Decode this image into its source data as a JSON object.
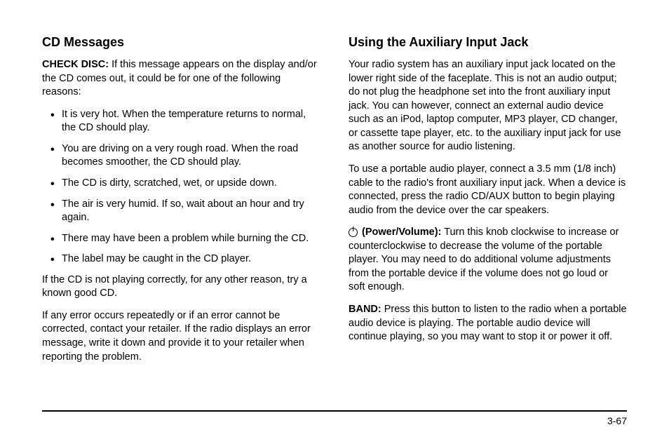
{
  "left": {
    "heading": "CD Messages",
    "check_disc_label": "CHECK DISC:",
    "check_disc_text": " If this message appears on the display and/or the CD comes out, it could be for one of the following reasons:",
    "bullets": [
      "It is very hot. When the temperature returns to normal, the CD should play.",
      "You are driving on a very rough road. When the road becomes smoother, the CD should play.",
      "The CD is dirty, scratched, wet, or upside down.",
      "The air is very humid. If so, wait about an hour and try again.",
      "There may have been a problem while burning the CD.",
      "The label may be caught in the CD player."
    ],
    "para2": "If the CD is not playing correctly, for any other reason, try a known good CD.",
    "para3": "If any error occurs repeatedly or if an error cannot be corrected, contact your retailer. If the radio displays an error message, write it down and provide it to your retailer when reporting the problem."
  },
  "right": {
    "heading": "Using the Auxiliary Input Jack",
    "para1": "Your radio system has an auxiliary input jack located on the lower right side of the faceplate. This is not an audio output; do not plug the headphone set into the front auxiliary input jack. You can however, connect an external audio device such as an iPod, laptop computer, MP3 player, CD changer, or cassette tape player, etc. to the auxiliary input jack for use as another source for audio listening.",
    "para2": "To use a portable audio player, connect a 3.5 mm (1/8 inch) cable to the radio's front auxiliary input jack. When a device is connected, press the radio CD/AUX button to begin playing audio from the device over the car speakers.",
    "power_label": " (Power/Volume):",
    "power_text": " Turn this knob clockwise to increase or counterclockwise to decrease the volume of the portable player. You may need to do additional volume adjustments from the portable device if the volume does not go loud or soft enough.",
    "band_label": "BAND:",
    "band_text": " Press this button to listen to the radio when a portable audio device is playing. The portable audio device will continue playing, so you may want to stop it or power it off."
  },
  "page_number": "3-67"
}
